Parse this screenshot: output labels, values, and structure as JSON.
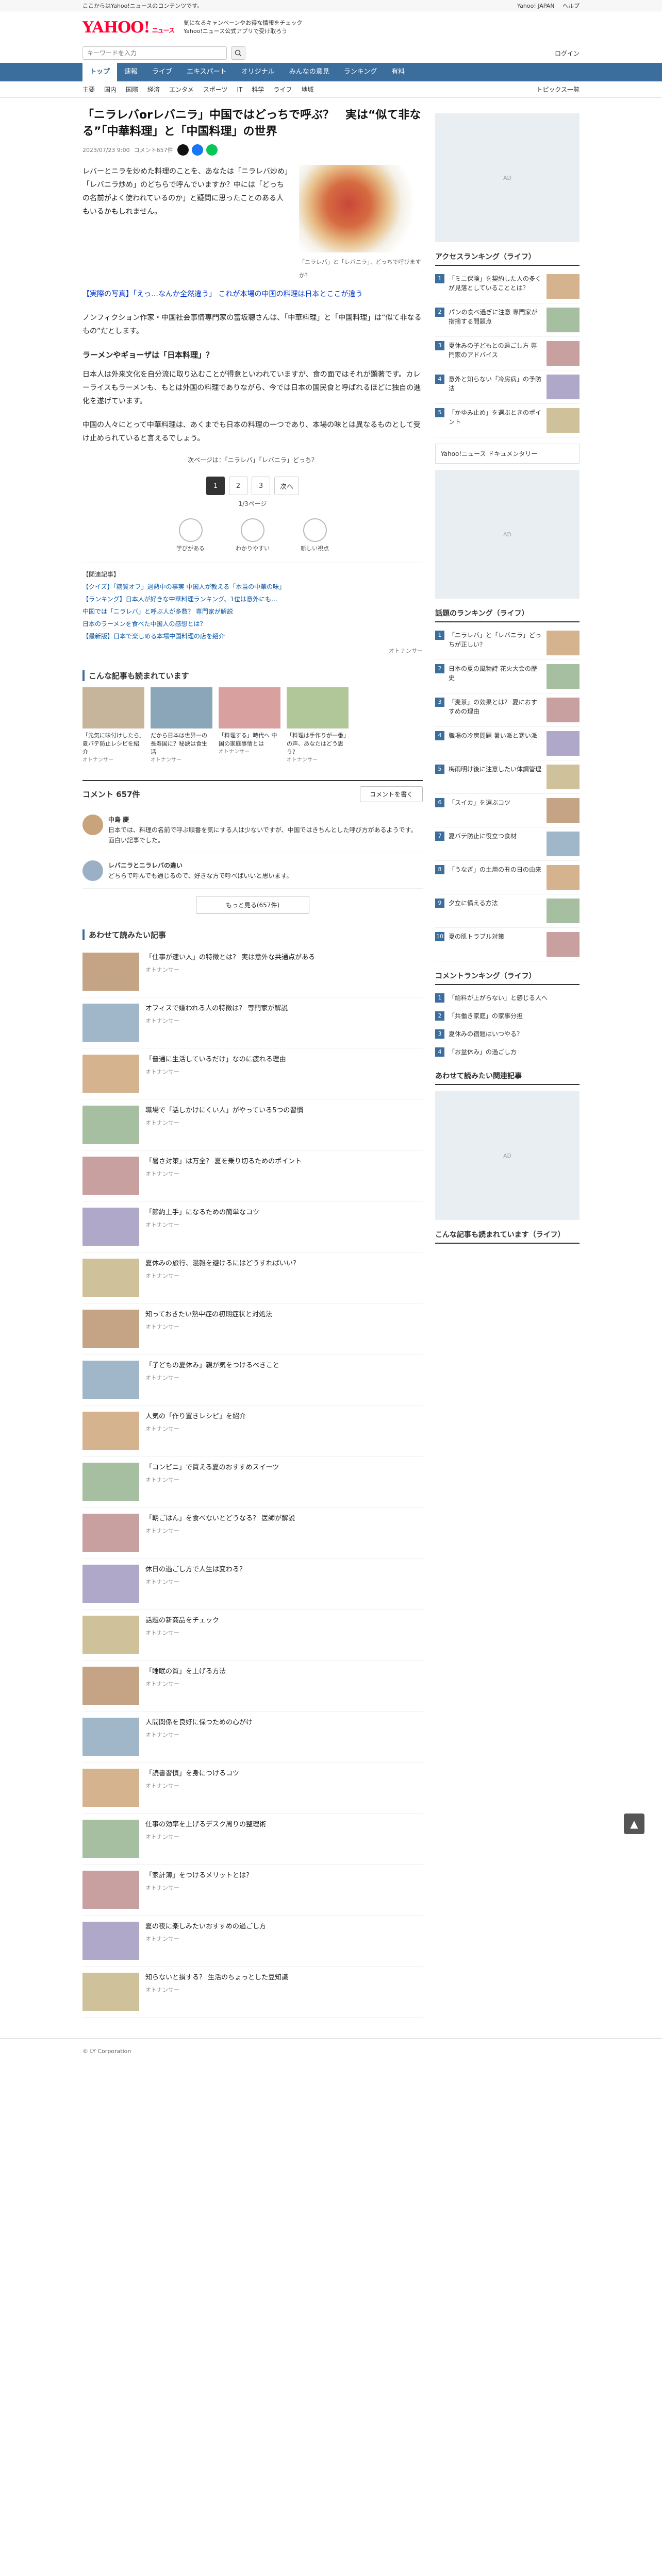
{
  "topbar": {
    "left": "ここからはYahoo!ニュースのコンテンツです。",
    "right": [
      "Yahoo! JAPAN",
      "ヘルプ"
    ]
  },
  "header": {
    "logo": "YAHOO!",
    "logo_sub": "ニュース",
    "promo_line1": "気になるキャンペーンやお得な情報をチェック",
    "promo_line2": "Yahoo!ニュース公式アプリで受け取ろう"
  },
  "search": {
    "placeholder": "キーワードを入力",
    "login": "ログイン"
  },
  "nav": {
    "items": [
      "トップ",
      "速報",
      "ライブ",
      "エキスパート",
      "オリジナル",
      "みんなの意見",
      "ランキング",
      "有料"
    ],
    "active": 0
  },
  "subnav": {
    "items": [
      "主要",
      "国内",
      "国際",
      "経済",
      "エンタメ",
      "スポーツ",
      "IT",
      "科学",
      "ライフ",
      "地域"
    ],
    "right": "トピックス一覧"
  },
  "article": {
    "title": "「ニラレバorレバニラ」中国ではどっちで呼ぶ？　実は“似て非なる”「中華料理」と「中国料理」の世界",
    "date": "2023/07/23 9:00",
    "comments_label": "コメント657件",
    "paragraphs": [
      "レバーとニラを炒めた料理のことを、あなたは「ニラレバ炒め」「レバニラ炒め」のどちらで呼んでいますか？中には「どっちの名前がよく使われているのか」と疑問に思ったことのある人もいるかもしれません。",
      "【実際の写真】「えっ…なんか全然違う」 これが本場の中国の料理は日本とここが違う",
      "ノンフィクション作家・中国社会事情専門家の富坂聰さんは、「中華料理」と「中国料理」は“似て非なるもの”だとします。",
      "日本人は外来文化を自分流に取り込むことが得意といわれていますが、食の面ではそれが顕著です。カレーライスもラーメンも、もとは外国の料理でありながら、今では日本の国民食と呼ばれるほどに独自の進化を遂げています。",
      "中国の人々にとって中華料理は、あくまでも日本の料理の一つであり、本場の味とは異なるものとして受け止められていると言えるでしょう。"
    ],
    "subheading": "ラーメンやギョーザは「日本料理」？",
    "caption": "「ニラレバ」と「レバニラ」、どっちで呼びますか？",
    "next_label": "次ページは：「ニラレバ」「レバニラ」どっち？",
    "pages": [
      "1",
      "2",
      "3"
    ],
    "next_btn": "次へ",
    "page_info": "1/3ページ",
    "reactions": [
      "学びがある",
      "わかりやすい",
      "新しい視点"
    ],
    "related": [
      "【関連記事】",
      "【クイズ】「糖質オフ」過熱中の事実 中国人が教える「本当の中華の味」",
      "【ランキング】日本人が好きな中華料理ランキング、1位は意外にも…",
      "中国では「ニラレバ」と呼ぶ人が多数？ 専門家が解説",
      "日本のラーメンを食べた中国人の感想とは？",
      "【最新版】日本で楽しめる本場中国料理の店を紹介"
    ],
    "source": "オトナンサー"
  },
  "recommend": {
    "title": "こんな記事も読まれています",
    "cards": [
      {
        "text": "「元気に味付けしたら」夏バテ防止レシピを紹介",
        "src": "オトナンサー"
      },
      {
        "text": "だから日本は世界一の長寿国に？秘訣は食生活",
        "src": "オトナンサー"
      },
      {
        "text": "「料理する」時代へ 中国の家庭事情とは",
        "src": "オトナンサー"
      },
      {
        "text": "「料理は手作りが一番」の声、あなたはどう思う？",
        "src": "オトナンサー"
      }
    ]
  },
  "comments": {
    "count_label": "コメント 657件",
    "write_btn": "コメントを書く",
    "items": [
      {
        "name": "中島 慶",
        "text": "日本では、料理の名前で呼ぶ順番を気にする人は少ないですが、中国ではきちんとした呼び方があるようです。面白い記事でした。"
      },
      {
        "name": "レバニラとニラレバの違い",
        "text": "どちらで呼んでも通じるので、好きな方で呼べばいいと思います。"
      }
    ],
    "more_btn": "もっと見る(657件)"
  },
  "more_articles": {
    "title": "あわせて読みたい記事",
    "items": [
      {
        "text": "「仕事が速い人」の特徴とは？ 実は意外な共通点がある",
        "src": "オトナンサー"
      },
      {
        "text": "オフィスで嫌われる人の特徴は？ 専門家が解説",
        "src": "オトナンサー"
      },
      {
        "text": "「普通に生活しているだけ」なのに疲れる理由",
        "src": "オトナンサー"
      },
      {
        "text": "職場で「話しかけにくい人」がやっている5つの習慣",
        "src": "オトナンサー"
      },
      {
        "text": "「暑さ対策」は万全？ 夏を乗り切るためのポイント",
        "src": "オトナンサー"
      },
      {
        "text": "「節約上手」になるための簡単なコツ",
        "src": "オトナンサー"
      },
      {
        "text": "夏休みの旅行、混雑を避けるにはどうすればいい？",
        "src": "オトナンサー"
      },
      {
        "text": "知っておきたい熱中症の初期症状と対処法",
        "src": "オトナンサー"
      },
      {
        "text": "「子どもの夏休み」親が気をつけるべきこと",
        "src": "オトナンサー"
      },
      {
        "text": "人気の「作り置きレシピ」を紹介",
        "src": "オトナンサー"
      },
      {
        "text": "「コンビニ」で買える夏のおすすめスイーツ",
        "src": "オトナンサー"
      },
      {
        "text": "「朝ごはん」を食べないとどうなる？ 医師が解説",
        "src": "オトナンサー"
      },
      {
        "text": "休日の過ごし方で人生は変わる？",
        "src": "オトナンサー"
      },
      {
        "text": "話題の新商品をチェック",
        "src": "オトナンサー"
      },
      {
        "text": "「睡眠の質」を上げる方法",
        "src": "オトナンサー"
      },
      {
        "text": "人間関係を良好に保つための心がけ",
        "src": "オトナンサー"
      },
      {
        "text": "「読書習慣」を身につけるコツ",
        "src": "オトナンサー"
      },
      {
        "text": "仕事の効率を上げるデスク周りの整理術",
        "src": "オトナンサー"
      },
      {
        "text": "「家計簿」をつけるメリットとは？",
        "src": "オトナンサー"
      },
      {
        "text": "夏の夜に楽しみたいおすすめの過ごし方",
        "src": "オトナンサー"
      },
      {
        "text": "知らないと損する？ 生活のちょっとした豆知識",
        "src": "オトナンサー"
      }
    ]
  },
  "sidebar": {
    "access_title": "アクセスランキング（ライフ）",
    "access": [
      "「ミニ保険」を契約した人の多くが見落としていることとは？",
      "パンの食べ過ぎに注意 専門家が指摘する問題点",
      "夏休みの子どもとの過ごし方 専門家のアドバイス",
      "意外と知らない「冷房病」の予防法",
      "「かゆみ止め」を選ぶときのポイント"
    ],
    "doc_title": "Yahoo!ニュース ドキュメンタリー",
    "hot_title": "話題のランキング（ライフ）",
    "hot": [
      "「ニラレバ」と「レバニラ」どっちが正しい？",
      "日本の夏の風物詩 花火大会の歴史",
      "「麦茶」の効果とは？ 夏におすすめの理由",
      "職場の冷房問題 暑い派と寒い派",
      "梅雨明け後に注意したい体調管理",
      "「スイカ」を選ぶコツ",
      "夏バテ防止に役立つ食材",
      "「うなぎ」の土用の丑の日の由来",
      "夕立に備える方法",
      "夏の肌トラブル対策"
    ],
    "comment_title": "コメントランキング（ライフ）",
    "comment": [
      "「給料が上がらない」と感じる人へ",
      "「共働き家庭」の家事分担",
      "夏休みの宿題はいつやる？",
      "「お盆休み」の過ごし方"
    ],
    "rec_title": "あわせて読みたい関連記事",
    "video_title": "こんな記事も読まれています（ライフ）"
  },
  "footer": {
    "text": "© LY Corporation"
  }
}
